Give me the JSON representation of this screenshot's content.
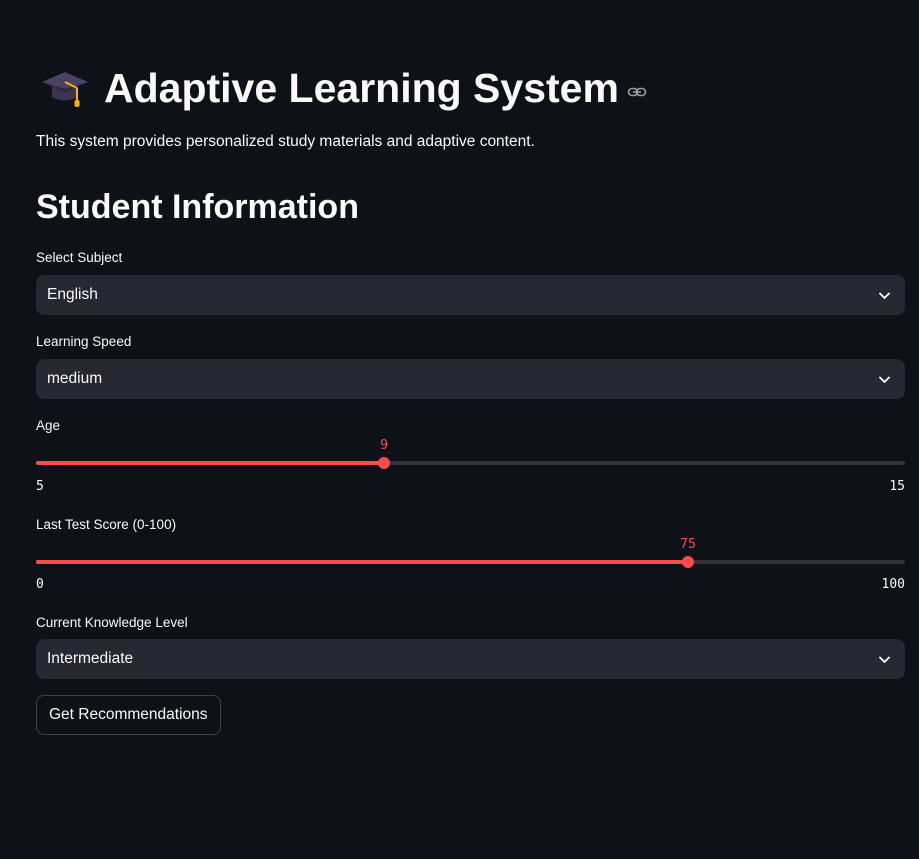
{
  "header": {
    "title": "Adaptive Learning System",
    "title_icon": "graduation-cap-icon",
    "anchor_icon": "link-icon",
    "description": "This system provides personalized study materials and adaptive content."
  },
  "section": {
    "title": "Student Information"
  },
  "subject": {
    "label": "Select Subject",
    "value": "English",
    "icon": "chevron-down-icon"
  },
  "speed": {
    "label": "Learning Speed",
    "value": "medium",
    "icon": "chevron-down-icon"
  },
  "age": {
    "label": "Age",
    "value": "9",
    "min": "5",
    "max": "15"
  },
  "score": {
    "label": "Last Test Score (0-100)",
    "value": "75",
    "min": "0",
    "max": "100"
  },
  "knowledge": {
    "label": "Current Knowledge Level",
    "value": "Intermediate",
    "icon": "chevron-down-icon"
  },
  "actions": {
    "recommend_label": "Get Recommendations"
  },
  "colors": {
    "background": "#0e1117",
    "accent": "#ff4b4b",
    "input_bg": "#262730",
    "track": "#31333f"
  }
}
